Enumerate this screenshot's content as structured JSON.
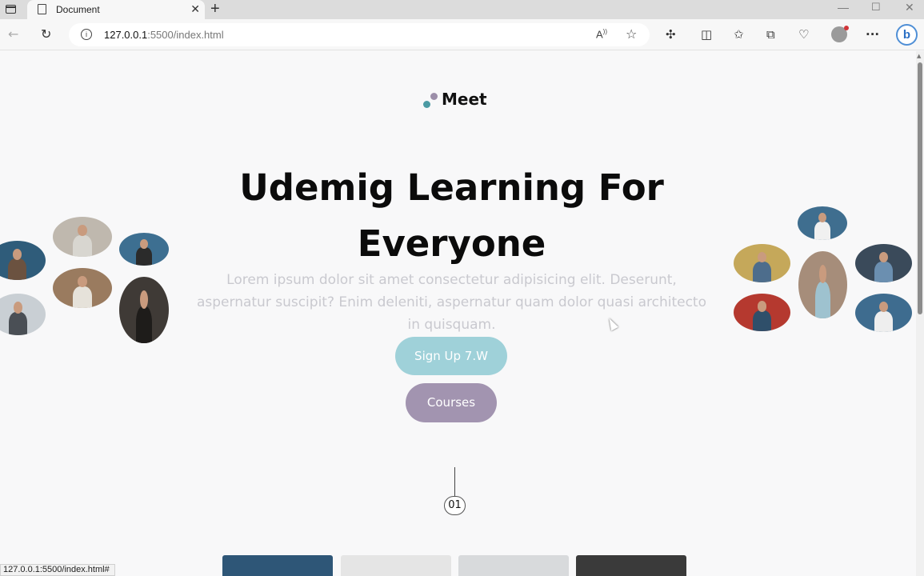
{
  "browser": {
    "tab_title": "Document",
    "tab_close": "✕",
    "new_tab": "+",
    "url_host": "127.0.0.1",
    "url_rest": ":5500/index.html",
    "status_url": "127.0.0.1:5500/index.html#"
  },
  "site": {
    "logo": "Meet",
    "hero_title": "Udemig Learning For Everyone",
    "hero_subtitle": "Lorem ipsum dolor sit amet consectetur adipisicing elit. Deserunt, aspernatur suscipit? Enim deleniti, aspernatur quam dolor quasi architecto in quisquam.",
    "signup_label": "Sign Up 7.W",
    "courses_label": "Courses",
    "step_number": "01"
  },
  "colors": {
    "signup_bg": "#9fd1d9",
    "courses_bg": "#a294b0",
    "logo_dot_teal": "#4b9aa3",
    "logo_dot_purple": "#9c8ea9"
  }
}
